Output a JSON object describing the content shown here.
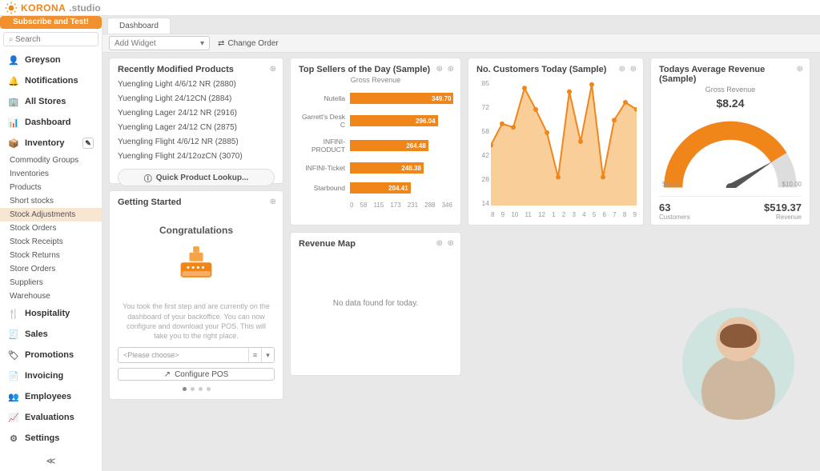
{
  "brand": {
    "name1": "KORONA",
    "name2": ".studio"
  },
  "subscribe": "Subscribe and Test!",
  "search_placeholder": "Search",
  "nav": {
    "greyson": "Greyson",
    "notifications": "Notifications",
    "allstores": "All Stores",
    "dashboard": "Dashboard",
    "inventory": "Inventory",
    "subs": [
      "Commodity Groups",
      "Inventories",
      "Products",
      "Short stocks",
      "Stock Adjustments",
      "Stock Orders",
      "Stock Receipts",
      "Stock Returns",
      "Store Orders",
      "Suppliers",
      "Warehouse"
    ],
    "hospitality": "Hospitality",
    "sales": "Sales",
    "promotions": "Promotions",
    "invoicing": "Invoicing",
    "employees": "Employees",
    "evaluations": "Evaluations",
    "settings": "Settings"
  },
  "tab": "Dashboard",
  "toolbar": {
    "add_widget": "Add Widget",
    "change_order": "Change Order"
  },
  "rmp": {
    "title": "Recently Modified Products",
    "items": [
      "Yuengling Light 4/6/12 NR (2880)",
      "Yuengling Light 24/12CN (2884)",
      "Yuengling Lager 24/12 NR (2916)",
      "Yuengling Lager 24/12 CN (2875)",
      "Yuengling Flight 4/6/12 NR (2885)",
      "Yuengling Flight 24/12ozCN (3070)"
    ],
    "lookup": "Quick Product Lookup..."
  },
  "gs": {
    "title": "Getting Started",
    "congrats": "Congratulations",
    "text": "You took the first step and are currently on the dashboard of your backoffice. You can now configure and download your POS. This will take you to the right place.",
    "choose": "<Please choose>",
    "configure": "Configure POS"
  },
  "ts": {
    "title": "Top Sellers of the Day (Sample)",
    "sub": "Gross Revenue"
  },
  "chart_data": [
    {
      "type": "bar",
      "title": "Top Sellers of the Day (Sample)",
      "ylabel": "Gross Revenue",
      "orientation": "horizontal",
      "categories": [
        "Nutella",
        "Garrett's Desk C",
        "INFINI-PRODUCT",
        "INFINI-Ticket",
        "Starbound"
      ],
      "values": [
        349.7,
        296.04,
        264.48,
        248.38,
        204.41
      ],
      "xlim": [
        0,
        346
      ],
      "xticks": [
        0,
        58,
        115,
        173,
        231,
        288,
        346
      ]
    },
    {
      "type": "line",
      "title": "No. Customers Today (Sample)",
      "x": [
        8,
        9,
        10,
        11,
        12,
        1,
        2,
        3,
        4,
        5,
        6,
        7,
        8,
        9
      ],
      "values": [
        48,
        60,
        58,
        80,
        68,
        55,
        30,
        78,
        50,
        82,
        30,
        62,
        72,
        68
      ],
      "ylim": [
        14,
        85
      ],
      "yticks": [
        85,
        72,
        58,
        42,
        28,
        14
      ]
    },
    {
      "type": "gauge",
      "title": "Todays Average Revenue (Sample)",
      "sub": "Gross Revenue",
      "value": 8.24,
      "display": "$8.24",
      "range": [
        0.0,
        10.0
      ],
      "range_display": [
        "$0.00",
        "$10.00"
      ],
      "footer": {
        "customers": 63,
        "revenue": 519.37,
        "revenue_display": "$519.37"
      }
    }
  ],
  "nc": {
    "title": "No. Customers Today (Sample)"
  },
  "gauge": {
    "title": "Todays Average Revenue (Sample)",
    "sub": "Gross Revenue",
    "amount": "$8.24",
    "lo": "$0.00",
    "hi": "$10.00",
    "customers_n": "63",
    "customers_t": "Customers",
    "revenue_n": "$519.37",
    "revenue_t": "Revenue"
  },
  "rmap": {
    "title": "Revenue Map",
    "empty": "No data found for today."
  }
}
